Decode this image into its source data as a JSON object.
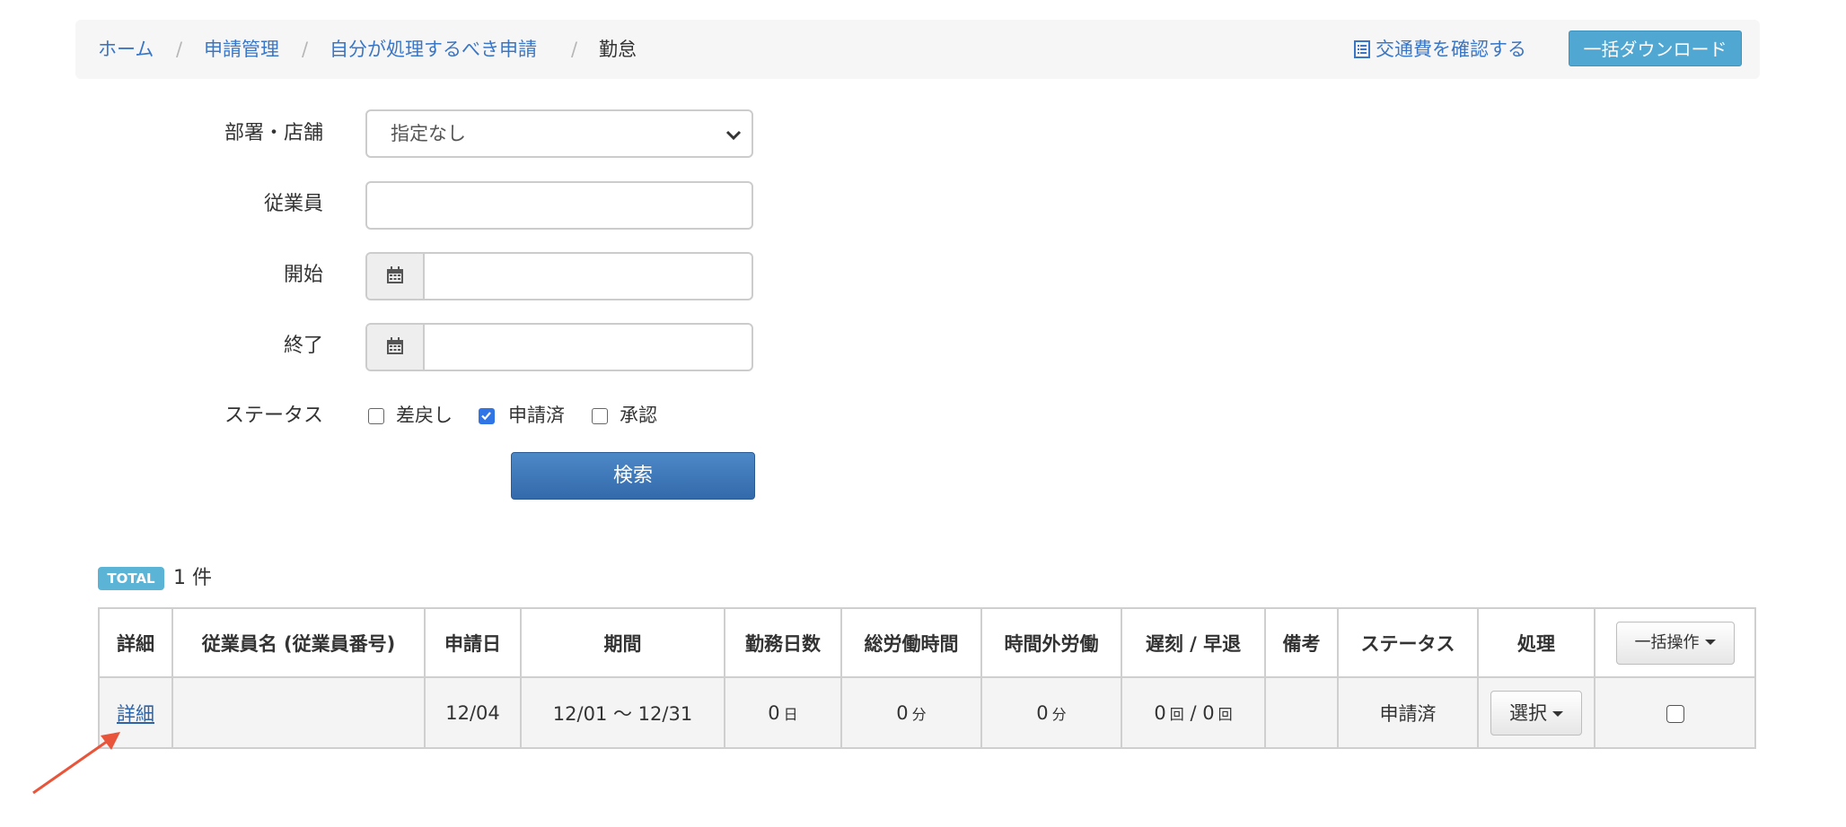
{
  "breadcrumb": {
    "items": [
      {
        "label": "ホーム"
      },
      {
        "label": "申請管理"
      },
      {
        "label": "自分が処理するべき申請"
      },
      {
        "label": "勤怠"
      }
    ],
    "separator": "/"
  },
  "header_actions": {
    "transport_link": "交通費を確認する",
    "bulk_download": "一括ダウンロード"
  },
  "filters": {
    "department": {
      "label": "部署・店舗",
      "value": "指定なし"
    },
    "employee": {
      "label": "従業員",
      "value": ""
    },
    "start": {
      "label": "開始",
      "value": ""
    },
    "end": {
      "label": "終了",
      "value": ""
    },
    "status": {
      "label": "ステータス",
      "options": [
        {
          "label": "差戻し",
          "checked": false
        },
        {
          "label": "申請済",
          "checked": true
        },
        {
          "label": "承認",
          "checked": false
        }
      ]
    },
    "search_button": "検索"
  },
  "summary": {
    "badge": "TOTAL",
    "count": "1 件"
  },
  "table": {
    "headers": [
      "詳細",
      "従業員名 (従業員番号)",
      "申請日",
      "期間",
      "勤務日数",
      "総労働時間",
      "時間外労働",
      "遅刻 / 早退",
      "備考",
      "ステータス",
      "処理"
    ],
    "bulk_action": "一括操作",
    "rows": [
      {
        "detail": "詳細",
        "employee": "",
        "applied": "12/04",
        "period": "12/01 〜 12/31",
        "work_days": "0",
        "work_days_unit": "日",
        "total_hours": "0",
        "total_hours_unit": "分",
        "overtime": "0",
        "overtime_unit": "分",
        "late": "0",
        "late_unit": "回",
        "late_sep": "/",
        "early": "0",
        "early_unit": "回",
        "note": "",
        "status": "申請済",
        "action": "選択"
      }
    ]
  },
  "colors": {
    "link": "#3a76c6",
    "download_button": "#4fa7d2",
    "search_button": "#336aab",
    "total_badge": "#5bb4d6",
    "annotation_arrow": "#e8553a"
  }
}
